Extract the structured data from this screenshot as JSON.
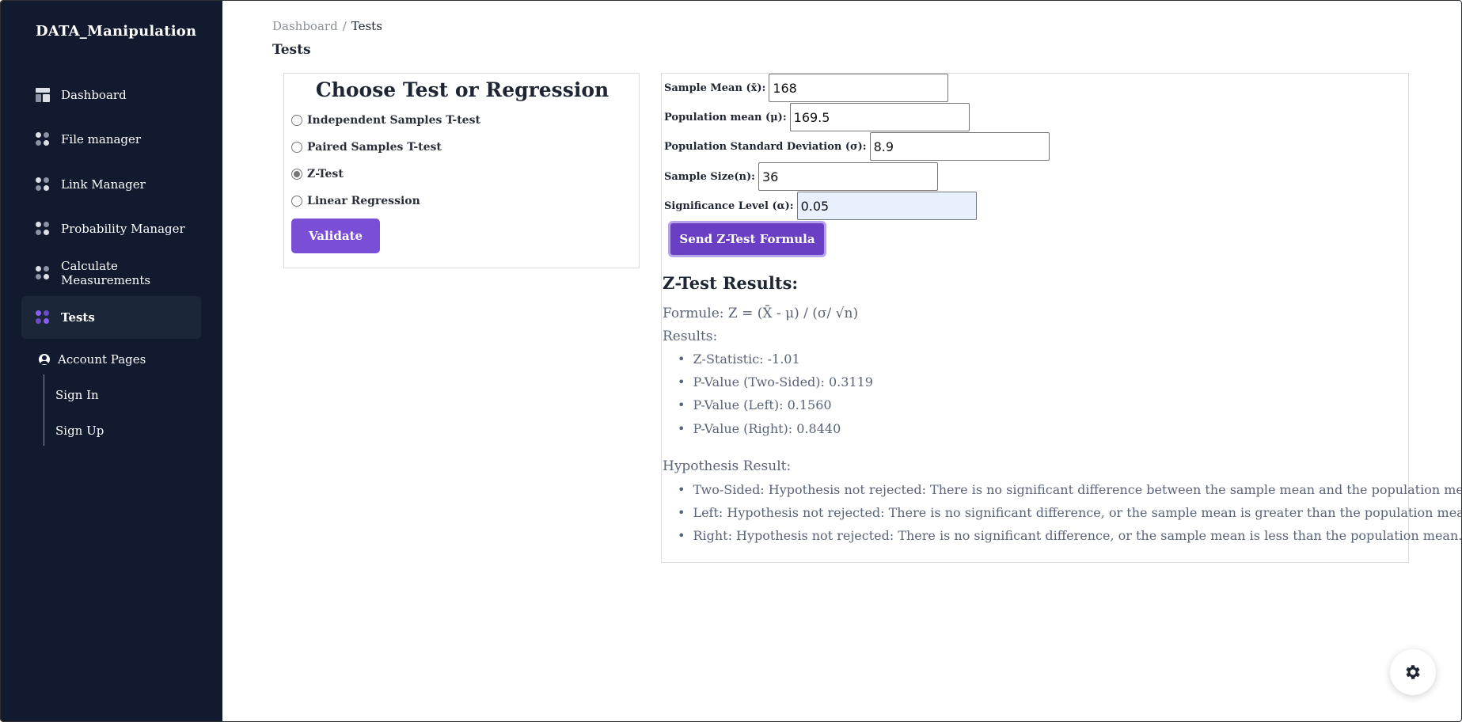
{
  "app": {
    "brand": "DATA_Manipulation"
  },
  "sidebar": {
    "items": [
      {
        "label": "Dashboard",
        "icon": "dashboard-icon"
      },
      {
        "label": "File manager",
        "icon": "apps-icon"
      },
      {
        "label": "Link Manager",
        "icon": "apps-icon"
      },
      {
        "label": "Probability Manager",
        "icon": "apps-icon"
      },
      {
        "label": "Calculate Measurements",
        "icon": "apps-icon"
      },
      {
        "label": "Tests",
        "icon": "apps-icon",
        "active": true
      }
    ],
    "account_section": "Account Pages",
    "sub_items": [
      "Sign In",
      "Sign Up"
    ]
  },
  "breadcrumb": {
    "root": "Dashboard",
    "separator": "/",
    "current": "Tests"
  },
  "page_title": "Tests",
  "choose": {
    "title": "Choose Test or Regression",
    "options": [
      {
        "label": "Independent Samples T-test",
        "checked": false
      },
      {
        "label": "Paired Samples T-test",
        "checked": false
      },
      {
        "label": "Z-Test",
        "checked": true
      },
      {
        "label": "Linear Regression",
        "checked": false
      }
    ],
    "validate_label": "Validate"
  },
  "ztest_form": {
    "fields": [
      {
        "label": "Sample Mean (x̄):",
        "value": "168"
      },
      {
        "label": "Population mean (μ):",
        "value": "169.5"
      },
      {
        "label": "Population Standard Deviation (σ):",
        "value": "8.9"
      },
      {
        "label": "Sample Size(n):",
        "value": "36"
      },
      {
        "label": "Significance Level (α):",
        "value": "0.05"
      }
    ],
    "send_label": "Send Z-Test Formula"
  },
  "results": {
    "title": "Z-Test Results:",
    "formula": "Formule: Z = (X̄ - μ) / (σ/ √n)",
    "results_label": "Results:",
    "items": [
      "Z-Statistic: -1.01",
      "P-Value (Two-Sided): 0.3119",
      "P-Value (Left): 0.1560",
      "P-Value (Right): 0.8440"
    ],
    "hypothesis_label": "Hypothesis Result:",
    "hypotheses": [
      "Two-Sided: Hypothesis not rejected: There is no significant difference between the sample mean and the population mean.",
      "Left: Hypothesis not rejected: There is no significant difference, or the sample mean is greater than the population mean.",
      "Right: Hypothesis not rejected: There is no significant difference, or the sample mean is less than the population mean."
    ]
  },
  "colors": {
    "sidebar_bg": "#111a2e",
    "accent": "#7a4fd6",
    "text_muted": "#5a6478"
  },
  "settings": {
    "icon": "gear-icon"
  }
}
